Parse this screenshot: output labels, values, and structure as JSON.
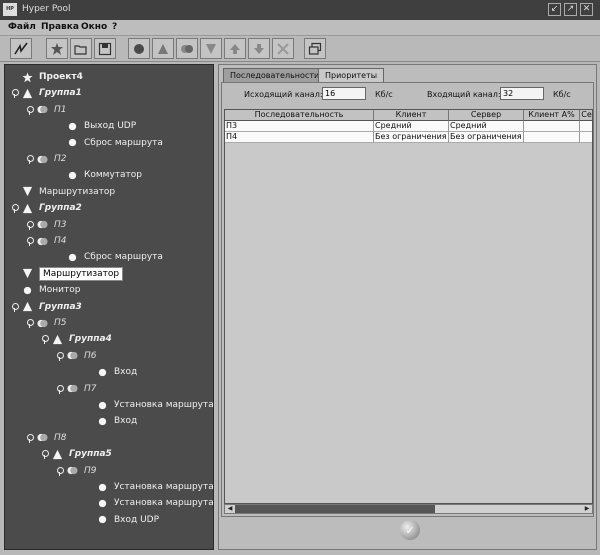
{
  "window": {
    "app_icon_text": "HP",
    "title": "Hyper Pool",
    "controls": [
      "↙",
      "↗",
      "✕"
    ]
  },
  "menu": [
    "Файл",
    "Правка",
    "Окно",
    "?"
  ],
  "toolbar": [
    "activity-icon",
    "settings-star-icon",
    "open-folder-icon",
    "save-disk-icon",
    "circle-icon",
    "triangle-icon",
    "double-circle-icon",
    "inverted-triangle-icon",
    "arrow-up-icon",
    "arrow-down-icon",
    "delete-cross-icon",
    "windows-icon"
  ],
  "tree": [
    {
      "label": "Проект4",
      "level": 0,
      "icon": "star",
      "type": "root",
      "key": false
    },
    {
      "label": "Группа1",
      "level": 0,
      "icon": "triangle",
      "type": "group",
      "key": true
    },
    {
      "label": "П1",
      "level": 1,
      "icon": "pair",
      "type": "sub",
      "key": true
    },
    {
      "label": "Выход UDP",
      "level": 3,
      "icon": "circle",
      "type": "leaf",
      "key": false
    },
    {
      "label": "Сброс маршрута",
      "level": 3,
      "icon": "circle",
      "type": "leaf",
      "key": false
    },
    {
      "label": "П2",
      "level": 1,
      "icon": "pair",
      "type": "sub",
      "key": true
    },
    {
      "label": "Коммутатор",
      "level": 3,
      "icon": "circle",
      "type": "leaf",
      "key": false
    },
    {
      "label": "Маршрутизатор",
      "level": 0,
      "icon": "down-triangle",
      "type": "leaf",
      "key": false
    },
    {
      "label": "Группа2",
      "level": 0,
      "icon": "triangle",
      "type": "group",
      "key": true
    },
    {
      "label": "П3",
      "level": 1,
      "icon": "pair",
      "type": "sub",
      "key": true
    },
    {
      "label": "П4",
      "level": 1,
      "icon": "pair",
      "type": "sub",
      "key": true
    },
    {
      "label": "Сброс маршрута",
      "level": 3,
      "icon": "circle",
      "type": "leaf",
      "key": false
    },
    {
      "label": "Маршрутизатор",
      "level": 0,
      "icon": "down-triangle",
      "type": "leaf",
      "key": false,
      "selected": true
    },
    {
      "label": "Монитор",
      "level": 0,
      "icon": "circle",
      "type": "leaf",
      "key": false
    },
    {
      "label": "Группа3",
      "level": 0,
      "icon": "triangle",
      "type": "group",
      "key": true
    },
    {
      "label": "П5",
      "level": 1,
      "icon": "pair",
      "type": "sub",
      "key": true
    },
    {
      "label": "Группа4",
      "level": 2,
      "icon": "triangle",
      "type": "group",
      "key": true
    },
    {
      "label": "П6",
      "level": 3,
      "icon": "pair",
      "type": "sub",
      "key": true
    },
    {
      "label": "Вход",
      "level": 5,
      "icon": "circle",
      "type": "leaf",
      "key": false
    },
    {
      "label": "П7",
      "level": 3,
      "icon": "pair",
      "type": "sub",
      "key": true
    },
    {
      "label": "Установка маршрута",
      "level": 5,
      "icon": "circle",
      "type": "leaf",
      "key": false
    },
    {
      "label": "Вход",
      "level": 5,
      "icon": "circle",
      "type": "leaf",
      "key": false
    },
    {
      "label": "П8",
      "level": 1,
      "icon": "pair",
      "type": "sub",
      "key": true
    },
    {
      "label": "Группа5",
      "level": 2,
      "icon": "triangle",
      "type": "group",
      "key": true
    },
    {
      "label": "П9",
      "level": 3,
      "icon": "pair",
      "type": "sub",
      "key": true
    },
    {
      "label": "Установка маршрута",
      "level": 5,
      "icon": "circle",
      "type": "leaf",
      "key": false
    },
    {
      "label": "Установка маршрута",
      "level": 5,
      "icon": "circle",
      "type": "leaf",
      "key": false
    },
    {
      "label": "Вход UDP",
      "level": 5,
      "icon": "circle",
      "type": "leaf",
      "key": false
    }
  ],
  "tabs": [
    {
      "label": "Последовательности",
      "active": true
    },
    {
      "label": "Приоритеты",
      "active": false
    }
  ],
  "channels": {
    "out_label": "Исходящий канал:",
    "out_value": "16",
    "out_unit": "Кб/с",
    "in_label": "Входящий канал:",
    "in_value": "32",
    "in_unit": "Кб/с"
  },
  "table": {
    "headers": [
      "Последовательность",
      "Клиент",
      "Сервер",
      "Клиент А%",
      "Се"
    ],
    "rows": [
      [
        "П3",
        "Средний",
        "Средний",
        "",
        ""
      ],
      [
        "П4",
        "Без ограничения",
        "Без ограничения",
        "",
        ""
      ]
    ]
  },
  "scroll": {
    "left_arrow": "◀",
    "right_arrow": "▶"
  },
  "ok_symbol": "✓"
}
